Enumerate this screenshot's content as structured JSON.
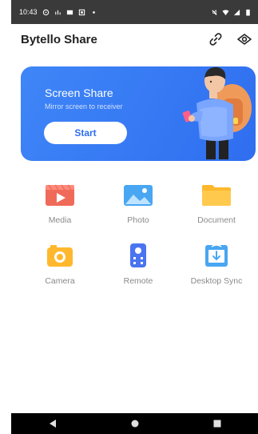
{
  "status_bar": {
    "time": "10:43",
    "left_icons": [
      "settings-icon",
      "signal-icon",
      "message-icon",
      "calendar-icon",
      "dot-icon"
    ],
    "right_icons": [
      "mute-icon",
      "wifi-icon",
      "signal-bars-icon",
      "battery-icon"
    ]
  },
  "header": {
    "title": "Bytello Share",
    "actions": [
      "link-icon",
      "eye-icon"
    ]
  },
  "banner": {
    "title": "Screen Share",
    "subtitle": "Mirror screen to receiver",
    "button_label": "Start",
    "colors": {
      "background": "#3f86f7",
      "button_text": "#2f6ef0"
    }
  },
  "features": [
    {
      "label": "Media",
      "icon": "media-icon",
      "color": "#f06a5a"
    },
    {
      "label": "Photo",
      "icon": "photo-icon",
      "color": "#49a6f2"
    },
    {
      "label": "Document",
      "icon": "document-icon",
      "color": "#ffb82e"
    },
    {
      "label": "Camera",
      "icon": "camera-icon",
      "color": "#ffb82e"
    },
    {
      "label": "Remote",
      "icon": "remote-icon",
      "color": "#4a74f0"
    },
    {
      "label": "Desktop Sync",
      "icon": "desktop-sync-icon",
      "color": "#49a6f2"
    }
  ],
  "nav_bar": {
    "buttons": [
      "back-icon",
      "home-icon",
      "recents-icon"
    ]
  }
}
